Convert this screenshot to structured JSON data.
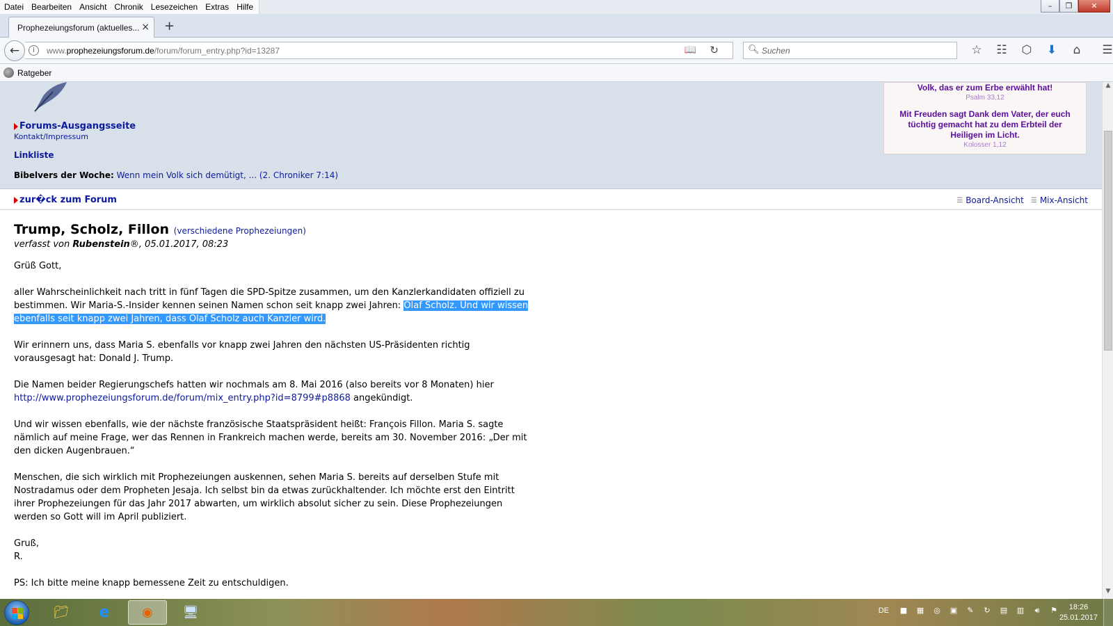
{
  "menubar": {
    "items": [
      "Datei",
      "Bearbeiten",
      "Ansicht",
      "Chronik",
      "Lesezeichen",
      "Extras",
      "Hilfe"
    ]
  },
  "window_controls": [
    "–",
    "❐",
    "✕"
  ],
  "tab": {
    "title": "Prophezeiungsforum (aktuelles...",
    "close": "×",
    "new_tab": "+"
  },
  "navbar": {
    "url_prefix": "www.",
    "url_domain": "prophezeiungsforum.de",
    "url_path": "/forum/forum_entry.php?id=13287",
    "search_placeholder": "Suchen"
  },
  "bookmarks": {
    "items": [
      "Ratgeber"
    ]
  },
  "header": {
    "forum_home": "Forums-Ausgangsseite",
    "contact": "Kontakt/Impressum",
    "linkliste": "Linkliste",
    "verse_week_label": "Bibelvers der Woche:",
    "verse_week_link": "Wenn mein Volk sich demütigt, ... (2. Chroniker 7:14)"
  },
  "verse_box": {
    "text1": "Volk, das er zum Erbe erwählt hat!",
    "ref1": "Psalm 33,12",
    "text2": "Mit Freuden sagt Dank dem Vater, der euch tüchtig gemacht hat zu dem Erbteil der Heiligen im Licht.",
    "ref2": "Kolosser 1,12"
  },
  "forum_bar": {
    "back": "zur�ck zum Forum",
    "board_view": "Board-Ansicht",
    "mix_view": "Mix-Ansicht"
  },
  "post": {
    "title": "Trump, Scholz, Fillon",
    "category": "(verschiedene Prophezeiungen)",
    "meta_prefix": "verfasst von ",
    "author": "Rubenstein",
    "meta_suffix": "®, 05.01.2017, 08:23",
    "greeting": "Grüß Gott,",
    "p1_a": "aller Wahrscheinlichkeit nach tritt in fünf Tagen die SPD-Spitze zusammen, um den Kanzlerkandidaten offiziell zu bestimmen. Wir Maria-S.-Insider kennen seinen Namen schon seit knapp zwei Jahren: ",
    "p1_highlight": "Olaf Scholz. Und wir wissen ebenfalls seit knapp zwei Jahren, dass Olaf Scholz auch Kanzler wird.",
    "p2": "Wir erinnern uns, dass Maria S. ebenfalls vor knapp zwei Jahren den nächsten US-Präsidenten richtig vorausgesagt hat: Donald J. Trump.",
    "p3_a": "Die Namen beider Regierungschefs hatten wir nochmals am 8. Mai 2016 (also bereits vor 8 Monaten) hier ",
    "p3_link": "http://www.prophezeiungsforum.de/forum/mix_entry.php?id=8799#p8868",
    "p3_b": " angekündigt.",
    "p4": "Und wir wissen ebenfalls, wie der nächste französische Staatspräsident heißt: François Fillon. Maria S. sagte nämlich auf meine Frage, wer das Rennen in Frankreich machen werde, bereits am 30. November 2016: „Der mit den dicken Augenbrauen.“",
    "p5": "Menschen, die sich wirklich mit Prophezeiungen auskennen, sehen Maria S. bereits auf derselben Stufe mit Nostradamus oder dem Propheten Jesaja. Ich selbst bin da etwas zurückhaltender. Ich möchte erst den Eintritt ihrer Prophezeiungen für das Jahr 2017 abwarten, um wirklich absolut sicher zu sein. Diese Prophezeiungen werden so Gott will im April publiziert.",
    "closing1": "Gruß,",
    "closing2": "R.",
    "ps": "PS: Ich bitte meine knapp bemessene Zeit zu entschuldigen."
  },
  "taskbar": {
    "language": "DE",
    "time": "18:26",
    "date": "25.01.2017"
  }
}
